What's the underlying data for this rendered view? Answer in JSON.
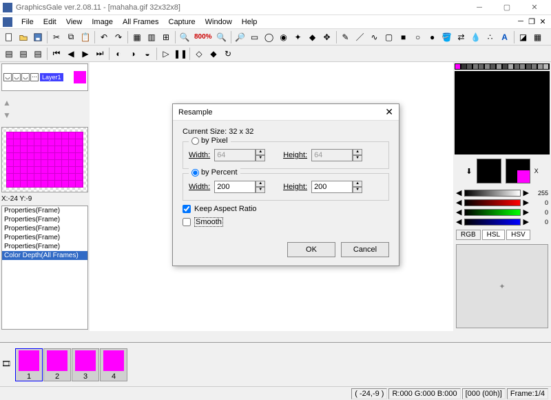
{
  "app": {
    "title": "GraphicsGale ver.2.08.11 - [mahaha.gif 32x32x8]"
  },
  "menu": [
    "File",
    "Edit",
    "View",
    "Image",
    "All Frames",
    "Capture",
    "Window",
    "Help"
  ],
  "zoom": "800%",
  "layer": {
    "name": "Layer1"
  },
  "coords": "X:-24 Y:-9",
  "history": [
    "Properties(Frame)",
    "Properties(Frame)",
    "Properties(Frame)",
    "Properties(Frame)",
    "Properties(Frame)",
    "Color Depth(All Frames)"
  ],
  "sliders": {
    "grey": 255,
    "r": 0,
    "g": 0,
    "b": 0
  },
  "tabs": [
    "RGB",
    "HSL",
    "HSV"
  ],
  "frames": [
    "1",
    "2",
    "3",
    "4"
  ],
  "status": {
    "pos": "( -24,-9 )",
    "rgb": "R:000 G:000 B:000",
    "idx": "[000 (00h)]",
    "frame": "Frame:1/4"
  },
  "dialog": {
    "title": "Resample",
    "current": "Current Size: 32 x 32",
    "byPixel": "by Pixel",
    "byPercent": "by Percent",
    "width": "Width:",
    "height": "Height:",
    "px_w": "64",
    "px_h": "64",
    "pc_w": "200",
    "pc_h": "200",
    "keep": "Keep Aspect Ratio",
    "smooth": "Smooth",
    "ok": "OK",
    "cancel": "Cancel"
  }
}
